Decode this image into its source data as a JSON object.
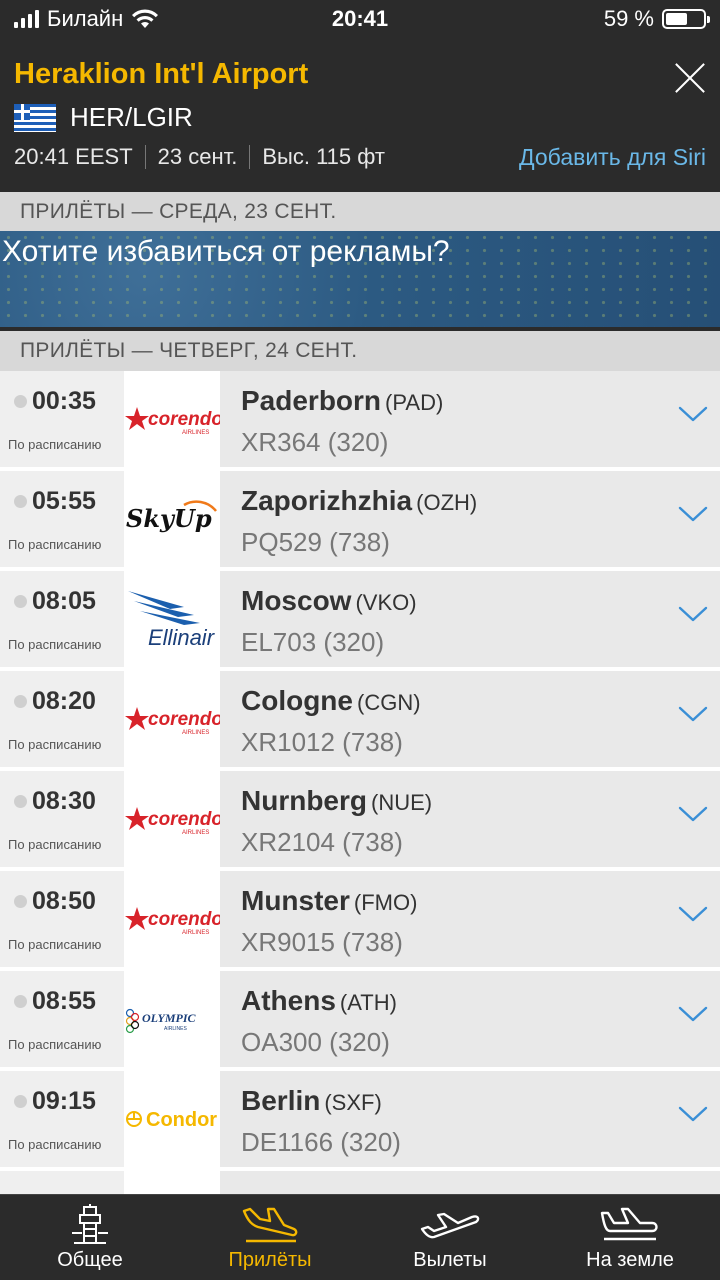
{
  "status_bar": {
    "carrier": "Билайн",
    "time": "20:41",
    "battery": "59 %",
    "battery_level": 0.59
  },
  "airport": {
    "name": "Heraklion Int'l Airport",
    "codes": "HER/LGIR",
    "local_time": "20:41 EEST",
    "date": "23 сент.",
    "elevation": "Выс. 115 фт",
    "siri_link": "Добавить для Siri"
  },
  "sections": {
    "wednesday": "ПРИЛЁТЫ — СРЕДА, 23 СЕНТ.",
    "thursday": "ПРИЛЁТЫ — ЧЕТВЕРГ, 24 СЕНТ."
  },
  "ad": {
    "text": "Хотите избавиться от рекламы?"
  },
  "flights": [
    {
      "time": "00:35",
      "status": "По расписанию",
      "airline": "corendon-logo",
      "city": "Paderborn",
      "iata": "(PAD)",
      "flight": "XR364 (320)"
    },
    {
      "time": "05:55",
      "status": "По расписанию",
      "airline": "skyup-logo",
      "city": "Zaporizhzhia",
      "iata": "(OZH)",
      "flight": "PQ529 (738)"
    },
    {
      "time": "08:05",
      "status": "По расписанию",
      "airline": "ellinair-logo",
      "city": "Moscow",
      "iata": "(VKO)",
      "flight": "EL703 (320)"
    },
    {
      "time": "08:20",
      "status": "По расписанию",
      "airline": "corendon-logo",
      "city": "Cologne",
      "iata": "(CGN)",
      "flight": "XR1012 (738)"
    },
    {
      "time": "08:30",
      "status": "По расписанию",
      "airline": "corendon-logo",
      "city": "Nurnberg",
      "iata": "(NUE)",
      "flight": "XR2104 (738)"
    },
    {
      "time": "08:50",
      "status": "По расписанию",
      "airline": "corendon-logo",
      "city": "Munster",
      "iata": "(FMO)",
      "flight": "XR9015 (738)"
    },
    {
      "time": "08:55",
      "status": "По расписанию",
      "airline": "olympic-logo",
      "city": "Athens",
      "iata": "(ATH)",
      "flight": "OA300 (320)"
    },
    {
      "time": "09:15",
      "status": "По расписанию",
      "airline": "condor-logo",
      "city": "Berlin",
      "iata": "(SXF)",
      "flight": "DE1166 (320)"
    }
  ],
  "logo_text": {
    "corendon": "corendon",
    "corendon_sub": "AIRLINES",
    "skyup": "SkyUp",
    "ellinair": "Ellinair",
    "olympic": "OLYMPIC",
    "olympic_sub": "AIRLINES",
    "condor": "Condor"
  },
  "tabs": [
    {
      "label": "Общее",
      "icon": "tower-icon"
    },
    {
      "label": "Прилёты",
      "icon": "arrivals-icon",
      "active": true
    },
    {
      "label": "Вылеты",
      "icon": "departures-icon"
    },
    {
      "label": "На земле",
      "icon": "on-ground-icon"
    }
  ],
  "colors": {
    "accent": "#f5b800",
    "siri": "#6ab8e8",
    "chevron": "#3a8fd6",
    "header_bg": "#2b2b2b"
  }
}
